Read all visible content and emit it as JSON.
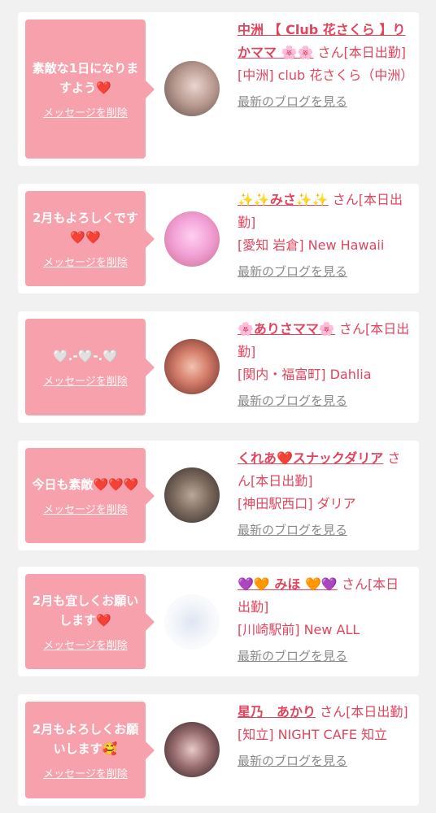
{
  "colors": {
    "page_bg": "#f1f1f1",
    "bubble": "#f7a1ad",
    "accent": "#e0455e",
    "link_gray": "#8a8a8a"
  },
  "delete_label": "メッセージを削除",
  "blog_label": "最新のブログを見る",
  "cards": [
    {
      "message": "素敵な1日になりますよう❤️",
      "name": "中洲 【 Club 花さくら 】りかママ 🌸🌸",
      "status": "さん[本日出勤]",
      "shop": "[中洲] club 花さくら（中洲）"
    },
    {
      "message": "2月もよろしくです❤️❤️",
      "name": "✨✨みさ✨✨",
      "status": "さん[本日出勤]",
      "shop": "[愛知 岩倉] New Hawaii"
    },
    {
      "message": "🤍.-🤍-.🤍",
      "name": "🌸ありさママ🌸",
      "status": "さん[本日出勤]",
      "shop": "[関内・福富町] Dahlia"
    },
    {
      "message": "今日も素敵❤️❤️❤️",
      "name": "くれあ❤️スナックダリア",
      "status": "さん[本日出勤]",
      "shop": "[神田駅西口] ダリア"
    },
    {
      "message": "2月も宜しくお願いします❤️",
      "name": "💜🧡 みほ 🧡💜",
      "status": "さん[本日出勤]",
      "shop": "[川崎駅前] New ALL"
    },
    {
      "message": "2月もよろしくお願いします🥰",
      "name": "星乃　あかり",
      "status": "さん[本日出勤]",
      "shop": "[知立] NIGHT CAFE 知立"
    }
  ]
}
